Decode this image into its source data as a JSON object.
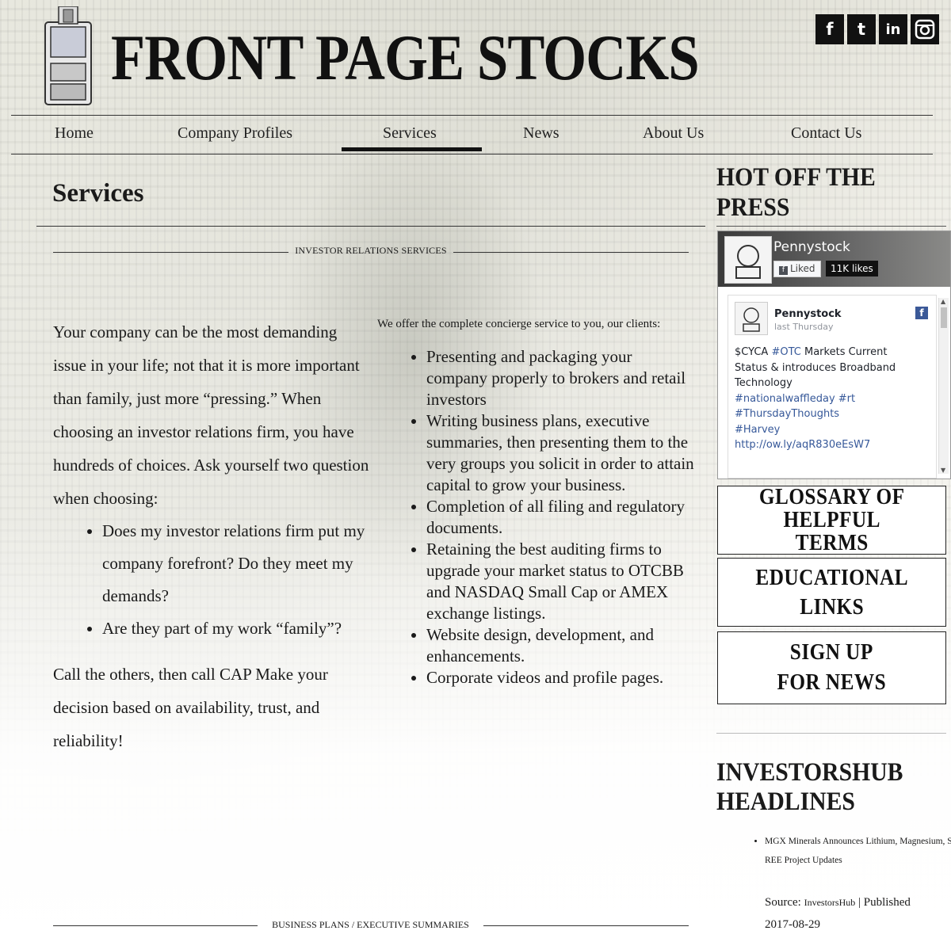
{
  "site": {
    "title": "FRONT PAGE STOCKS",
    "logo_text": "FRONTPAGE STOCKS"
  },
  "social": [
    {
      "name": "facebook",
      "glyph": "f"
    },
    {
      "name": "twitter",
      "glyph": "t"
    },
    {
      "name": "linkedin",
      "glyph": "in"
    },
    {
      "name": "instagram",
      "glyph": "◙"
    }
  ],
  "nav": {
    "items": [
      "Home",
      "Company Profiles",
      "Services",
      "News",
      "About Us",
      "Contact Us"
    ],
    "active": "Services"
  },
  "main": {
    "page_title": "Services",
    "section_label": "INVESTOR RELATIONS SERVICES",
    "left_intro": "Your company can be the most demanding issue in your life; not that it is more important than family, just more “pressing.” When choosing an investor relations firm, you have hundreds of choices. Ask yourself two question when choosing:",
    "left_bullets": [
      "Does my investor relations firm put my company forefront? Do they meet my demands?",
      "Are they part of my work “family”?"
    ],
    "left_outro": "Call the others, then call CAP Make your decision based on availability, trust, and reliability!",
    "right_intro": "We offer the complete concierge service to you, our clients:",
    "right_bullets": [
      "Presenting and packaging your company properly to brokers and retail investors",
      "Writing business plans, executive summaries, then presenting them to the very groups you solicit in order to attain capital to grow your business.",
      "Completion of all filing and regulatory documents.",
      "Retaining the best auditing firms to upgrade your market status to OTCBB and NASDAQ Small Cap or AMEX exchange listings.",
      "Website design, development, and enhancements.",
      "Corporate videos and profile pages."
    ],
    "section2_label": "BUSINESS PLANS / EXECUTIVE SUMMARIES"
  },
  "sidebar": {
    "hot_title": "HOT OFF THE PRESS",
    "fb": {
      "page_name": "Pennystock",
      "liked_label": "Liked",
      "likes": "11K likes",
      "post_name": "Pennystock",
      "post_time": "last Thursday",
      "post_text": "$CYCA",
      "post_hashtag1": "#OTC",
      "post_text2": "Markets Current Status & introduces Broadband Technology",
      "post_tags": "#nationalwaffleday #rt",
      "post_tag2": "#ThursdayThoughts",
      "post_tag3": "#Harvey",
      "post_url": "http://ow.ly/aqR830eEsW7"
    },
    "buttons": {
      "glossary_line1": "GLOSSARY OF",
      "glossary_line2": "HELPFUL",
      "glossary_line3": "TERMS",
      "edu_line1": "EDUCATIONAL",
      "edu_line2": "LINKS",
      "sign_line1": "SIGN UP",
      "sign_line2": "FOR NEWS"
    },
    "ihub_title": "INVESTORSHUB HEADLINES",
    "ihub_items": [
      "MGX Minerals Announces Lithium, Magnesium, Silicon, and REE Project Updates"
    ],
    "ihub_source_label": "Source:",
    "ihub_source": "InvestorsHub",
    "ihub_published_label": "| Published",
    "ihub_date": "2017-08-29"
  },
  "colors": {
    "text": "#1a1a1a",
    "rule": "#333333",
    "fb_blue": "#3b5998",
    "link": "#365899"
  }
}
